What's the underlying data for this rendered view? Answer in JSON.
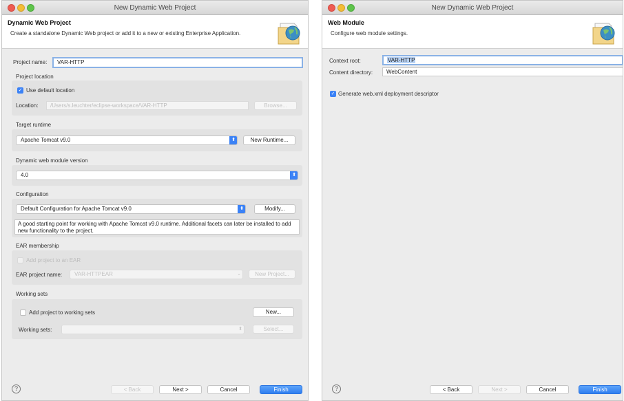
{
  "left_window": {
    "title": "New Dynamic Web Project",
    "banner_title": "Dynamic Web Project",
    "banner_description": "Create a standalone Dynamic Web project or add it to a new or existing Enterprise Application.",
    "project_name_label": "Project name:",
    "project_name_value": "VAR-HTTP",
    "project_location_section": "Project location",
    "use_default_location_label": "Use default location",
    "location_label": "Location:",
    "location_value": "/Users/s.leuchter/eclipse-workspace/VAR-HTTP",
    "browse_label": "Browse...",
    "target_runtime_section": "Target runtime",
    "target_runtime_value": "Apache Tomcat v9.0",
    "new_runtime_label": "New Runtime...",
    "module_version_section": "Dynamic web module version",
    "module_version_value": "4.0",
    "configuration_section": "Configuration",
    "configuration_value": "Default Configuration for Apache Tomcat v9.0",
    "modify_label": "Modify...",
    "configuration_description": "A good starting point for working with Apache Tomcat v9.0 runtime. Additional facets can later be installed to add new functionality to the project.",
    "ear_section": "EAR membership",
    "add_to_ear_label": "Add project to an EAR",
    "ear_project_name_label": "EAR project name:",
    "ear_project_name_value": "VAR-HTTPEAR",
    "new_project_label": "New Project...",
    "working_sets_section": "Working sets",
    "add_to_working_sets_label": "Add project to working sets",
    "new_label": "New...",
    "working_sets_label": "Working sets:",
    "select_label": "Select..."
  },
  "right_window": {
    "title": "New Dynamic Web Project",
    "banner_title": "Web Module",
    "banner_description": "Configure web module settings.",
    "context_root_label": "Context root:",
    "context_root_value": "VAR-HTTP",
    "content_directory_label": "Content directory:",
    "content_directory_value": "WebContent",
    "generate_xml_label": "Generate web.xml deployment descriptor"
  },
  "footer": {
    "help": "?",
    "back": "< Back",
    "next": "Next >",
    "cancel": "Cancel",
    "finish": "Finish"
  },
  "colors": {
    "accent": "#3b82f6",
    "window_bg": "#ececec",
    "group_bg": "#e2e2e2"
  },
  "icons": [
    "close-light",
    "minimize-light",
    "zoom-light",
    "wizard-globe-icon",
    "checkmark-icon",
    "dropdown-arrow-icon",
    "help-icon"
  ]
}
